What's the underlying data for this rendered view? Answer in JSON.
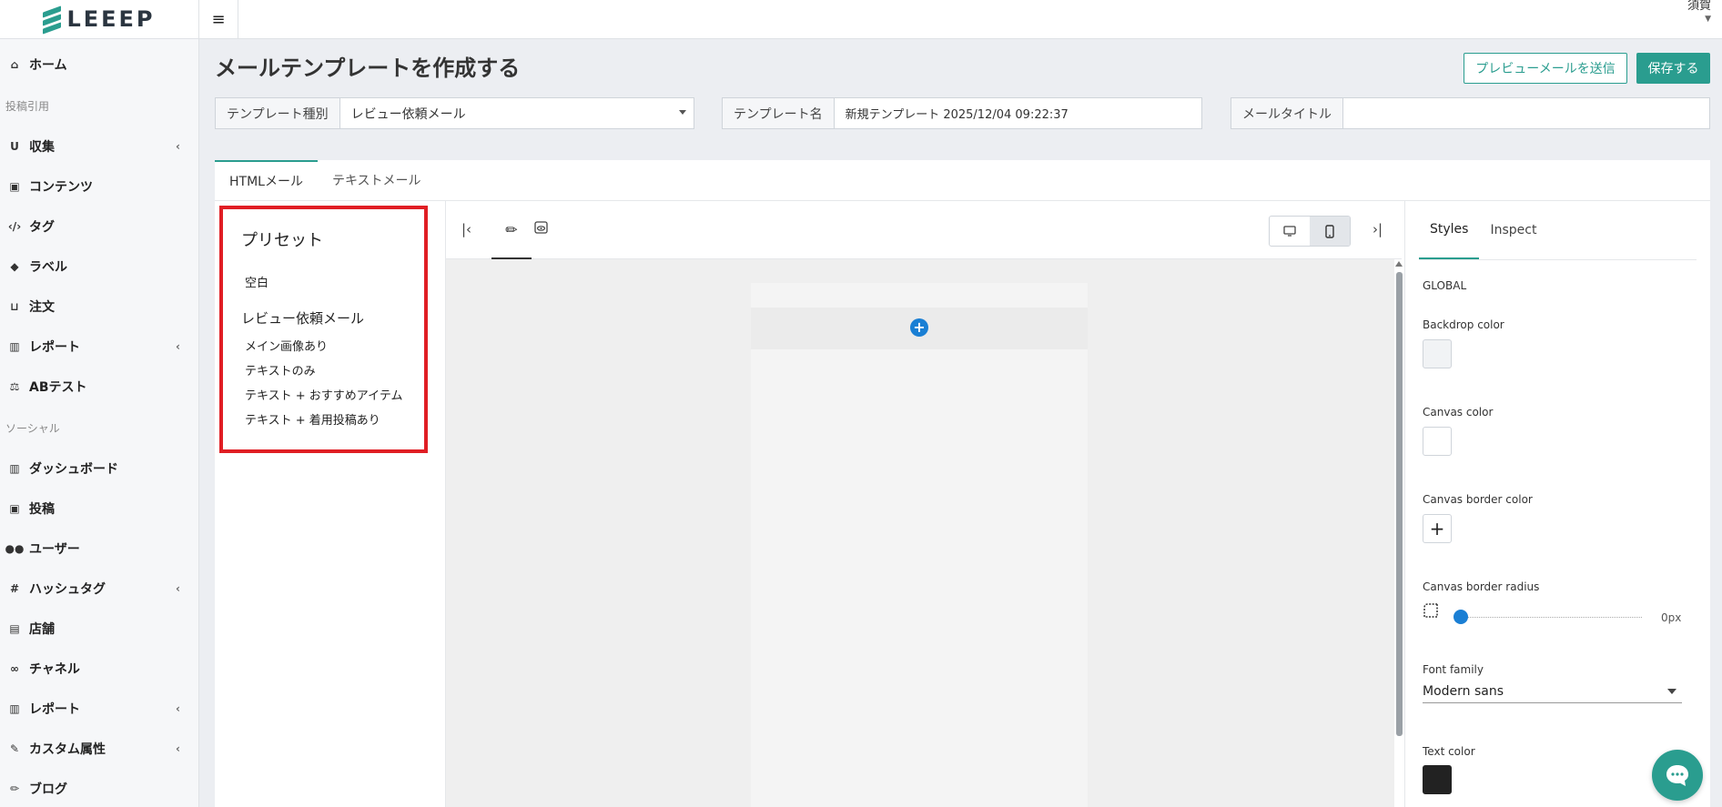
{
  "app": {
    "brand": "LEEEP",
    "user": "須賀"
  },
  "sidebar": {
    "items_top": [
      {
        "label": "ホーム",
        "icon": "home-icon"
      }
    ],
    "section1": "投稿引用",
    "items1": [
      {
        "label": "収集",
        "icon": "magnet-icon",
        "chevron": true
      },
      {
        "label": "コンテンツ",
        "icon": "image-icon",
        "chevron": false
      },
      {
        "label": "タグ",
        "icon": "code-icon",
        "chevron": false
      },
      {
        "label": "ラベル",
        "icon": "tag-icon",
        "chevron": false
      },
      {
        "label": "注文",
        "icon": "cart-icon",
        "chevron": false
      },
      {
        "label": "レポート",
        "icon": "bar-chart-icon",
        "chevron": true
      },
      {
        "label": "ABテスト",
        "icon": "scale-icon",
        "chevron": false
      }
    ],
    "section2": "ソーシャル",
    "items2": [
      {
        "label": "ダッシュボード",
        "icon": "bar-chart-icon",
        "chevron": false
      },
      {
        "label": "投稿",
        "icon": "image-icon",
        "chevron": false
      },
      {
        "label": "ユーザー",
        "icon": "users-icon",
        "chevron": false
      },
      {
        "label": "ハッシュタグ",
        "icon": "hash-icon",
        "chevron": true
      },
      {
        "label": "店舗",
        "icon": "building-icon",
        "chevron": false
      },
      {
        "label": "チャネル",
        "icon": "link-icon",
        "chevron": false
      },
      {
        "label": "レポート",
        "icon": "bar-chart-icon",
        "chevron": true
      },
      {
        "label": "カスタム属性",
        "icon": "wrench-icon",
        "chevron": true
      },
      {
        "label": "ブログ",
        "icon": "pencil-icon",
        "chevron": false
      }
    ]
  },
  "page": {
    "title": "メールテンプレートを作成する",
    "preview_button": "プレビューメールを送信",
    "save_button": "保存する"
  },
  "fields": {
    "type_label": "テンプレート種別",
    "type_value": "レビュー依頼メール",
    "name_label": "テンプレート名",
    "name_value": "新規テンプレート 2025/12/04 09:22:37",
    "subject_label": "メールタイトル",
    "subject_value": ""
  },
  "editor": {
    "tabs": [
      "HTMLメール",
      "テキストメール"
    ],
    "preset": {
      "title": "プリセット",
      "blank": "空白",
      "group": "レビュー依頼メール",
      "items": [
        "メイン画像あり",
        "テキストのみ",
        "テキスト + おすすめアイテム",
        "テキスト + 着用投稿あり"
      ]
    },
    "right_tabs": [
      "Styles",
      "Inspect"
    ],
    "styles": {
      "section": "GLOBAL",
      "backdrop_color_label": "Backdrop color",
      "canvas_color_label": "Canvas color",
      "canvas_border_color_label": "Canvas border color",
      "canvas_border_radius_label": "Canvas border radius",
      "canvas_border_radius_value": "0px",
      "font_family_label": "Font family",
      "font_family_value": "Modern sans",
      "text_color_label": "Text color"
    }
  },
  "colors": {
    "accent": "#2a9d8f",
    "add": "#1a7fd4",
    "highlight": "#e01e24",
    "backdrop": "#f1f3f5",
    "canvas": "#ffffff",
    "text": "#222222"
  }
}
